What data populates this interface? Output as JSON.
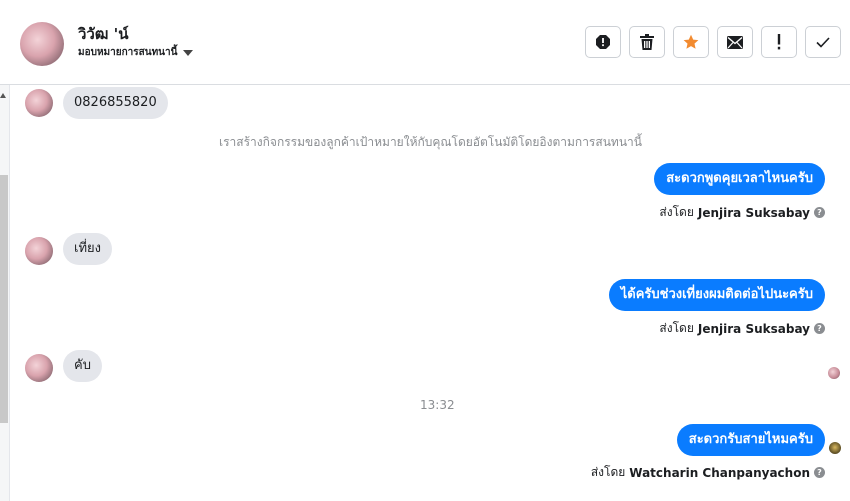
{
  "header": {
    "contact_name": "วิวัฒ 'น์",
    "assign_label": "มอบหมายการสนทนานี้",
    "actions": [
      "report-icon",
      "trash-icon",
      "star-icon",
      "mail-icon",
      "exclamation-icon",
      "check-icon"
    ],
    "star_color": "#f28b30"
  },
  "messages": {
    "m1": "0826855820",
    "notice": "เราสร้างกิจกรรมของลูกค้าเป้าหมายให้กับคุณโดยอัตโนมัติโดยอิงตามการสนทนานี้",
    "m2": "สะดวกพูดคุยเวลาไหนครับ",
    "m2_sentby_prefix": "ส่งโดย",
    "m2_sender": "Jenjira Suksabay",
    "m3": "เที่ยง",
    "m4": "ได้ครับช่วงเที่ยงผมติดต่อไปนะครับ",
    "m4_sentby_prefix": "ส่งโดย",
    "m4_sender": "Jenjira Suksabay",
    "m5": "คับ",
    "time": "13:32",
    "m6": "สะดวกรับสายไหมครับ",
    "m6_sentby_prefix": "ส่งโดย",
    "m6_sender": "Watcharin Chanpanyachon"
  },
  "colors": {
    "outgoing_bubble": "#0a7cff",
    "incoming_bubble": "#e4e6eb"
  }
}
